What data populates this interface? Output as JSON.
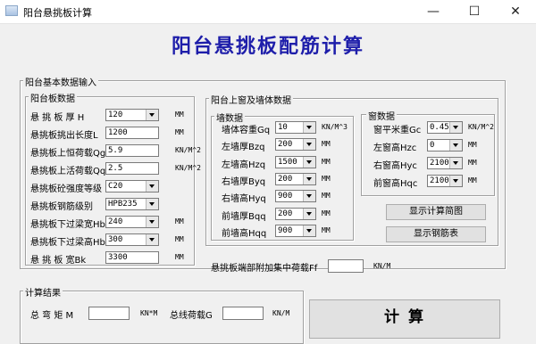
{
  "window": {
    "title": "阳台悬挑板计算",
    "minimize": "—",
    "maximize": "☐",
    "close": "✕"
  },
  "heading": "阳台悬挑板配筋计算",
  "input_section": "阳台基本数据输入",
  "slab": {
    "title": "阳台板数据",
    "rows": [
      {
        "label": "悬 挑 板 厚 H",
        "value": "120",
        "type": "combo",
        "unit": "MM"
      },
      {
        "label": "悬挑板挑出长度L",
        "value": "1200",
        "type": "text",
        "unit": "MM"
      },
      {
        "label": "悬挑板上恒荷载Qg",
        "value": "5.9",
        "type": "text",
        "unit": "KN/M^2"
      },
      {
        "label": "悬挑板上活荷载Qq",
        "value": "2.5",
        "type": "text",
        "unit": "KN/M^2"
      },
      {
        "label": "悬挑板砼强度等级",
        "value": "C20",
        "type": "combo",
        "unit": ""
      },
      {
        "label": "悬挑板钢筋级别",
        "value": "HPB235",
        "type": "combo",
        "unit": ""
      },
      {
        "label": "悬挑板下过梁宽Hb",
        "value": "240",
        "type": "combo",
        "unit": "MM"
      },
      {
        "label": "悬挑板下过梁高Hb",
        "value": "300",
        "type": "combo",
        "unit": "MM"
      },
      {
        "label": "悬 挑 板 宽Bk",
        "value": "3300",
        "type": "text",
        "unit": "MM"
      }
    ]
  },
  "window_wall": {
    "title": "阳台上窗及墙体数据",
    "wall": {
      "title": "墙数据",
      "rows": [
        {
          "label": "墙体容重Gq",
          "value": "10",
          "unit": "KN/M^3"
        },
        {
          "label": "左墙厚Bzq",
          "value": "200",
          "unit": "MM"
        },
        {
          "label": "左墙高Hzq",
          "value": "1500",
          "unit": "MM"
        },
        {
          "label": "右墙厚Byq",
          "value": "200",
          "unit": "MM"
        },
        {
          "label": "右墙高Hyq",
          "value": "900",
          "unit": "MM"
        },
        {
          "label": "前墙厚Bqq",
          "value": "200",
          "unit": "MM"
        },
        {
          "label": "前墙高Hqq",
          "value": "900",
          "unit": "MM"
        }
      ]
    },
    "window": {
      "title": "窗数据",
      "rows": [
        {
          "label": "窗平米重Gc",
          "value": "0.45",
          "unit": "KN/M^2"
        },
        {
          "label": "左窗高Hzc",
          "value": "0",
          "unit": "MM"
        },
        {
          "label": "右窗高Hyc",
          "value": "2100",
          "unit": "MM"
        },
        {
          "label": "前窗高Hqc",
          "value": "2100",
          "unit": "MM"
        }
      ]
    },
    "btn_diagram": "显示计算简图",
    "btn_rebar": "显示钢筋表"
  },
  "end_load": {
    "label": "悬挑板端部附加集中荷载Ff",
    "value": "",
    "unit": "KN/M"
  },
  "results": {
    "title": "计算结果",
    "moment_label": "总 弯 矩 M",
    "moment_value": "",
    "moment_unit": "KN*M",
    "load_label": "总线荷载G",
    "load_value": "",
    "load_unit": "KN/M"
  },
  "calc_button": "计  算"
}
